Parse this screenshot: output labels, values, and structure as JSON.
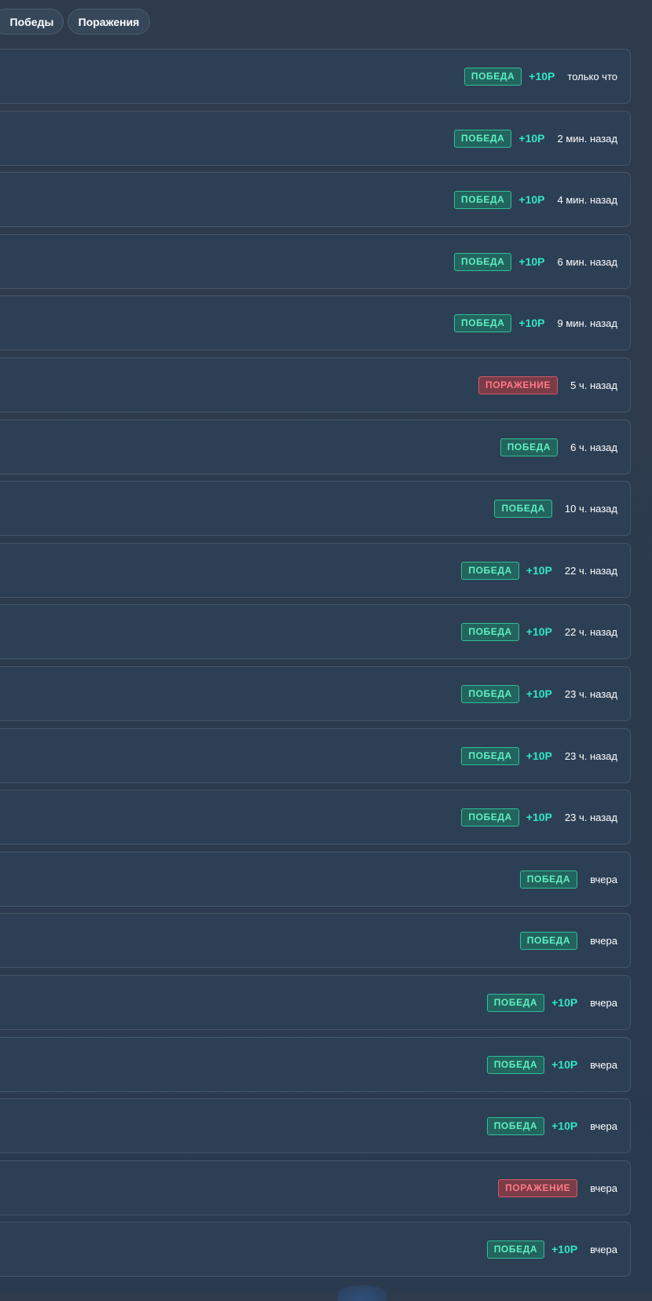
{
  "filters": {
    "wins_label": "Победы",
    "losses_label": "Поражения"
  },
  "colors": {
    "win_text": "#5ff0c2",
    "win_bg": "#23645e",
    "loss_text": "#ff7a86",
    "loss_bg": "#7a3c47",
    "reward": "#2ee8c4",
    "row_bg": "#2d3f54"
  },
  "history": [
    {
      "result": "ПОБЕДА",
      "type": "win",
      "reward": "+10Р",
      "time": "только что"
    },
    {
      "result": "ПОБЕДА",
      "type": "win",
      "reward": "+10Р",
      "time": "2 мин. назад"
    },
    {
      "result": "ПОБЕДА",
      "type": "win",
      "reward": "+10Р",
      "time": "4 мин. назад"
    },
    {
      "result": "ПОБЕДА",
      "type": "win",
      "reward": "+10Р",
      "time": "6 мин. назад"
    },
    {
      "result": "ПОБЕДА",
      "type": "win",
      "reward": "+10Р",
      "time": "9 мин. назад"
    },
    {
      "result": "ПОРАЖЕНИЕ",
      "type": "loss",
      "reward": "",
      "time": "5 ч. назад"
    },
    {
      "result": "ПОБЕДА",
      "type": "win",
      "reward": "",
      "time": "6 ч. назад"
    },
    {
      "result": "ПОБЕДА",
      "type": "win",
      "reward": "",
      "time": "10 ч. назад"
    },
    {
      "result": "ПОБЕДА",
      "type": "win",
      "reward": "+10Р",
      "time": "22 ч. назад"
    },
    {
      "result": "ПОБЕДА",
      "type": "win",
      "reward": "+10Р",
      "time": "22 ч. назад"
    },
    {
      "result": "ПОБЕДА",
      "type": "win",
      "reward": "+10Р",
      "time": "23 ч. назад"
    },
    {
      "result": "ПОБЕДА",
      "type": "win",
      "reward": "+10Р",
      "time": "23 ч. назад"
    },
    {
      "result": "ПОБЕДА",
      "type": "win",
      "reward": "+10Р",
      "time": "23 ч. назад"
    },
    {
      "result": "ПОБЕДА",
      "type": "win",
      "reward": "",
      "time": "вчера"
    },
    {
      "result": "ПОБЕДА",
      "type": "win",
      "reward": "",
      "time": "вчера"
    },
    {
      "result": "ПОБЕДА",
      "type": "win",
      "reward": "+10Р",
      "time": "вчера"
    },
    {
      "result": "ПОБЕДА",
      "type": "win",
      "reward": "+10Р",
      "time": "вчера"
    },
    {
      "result": "ПОБЕДА",
      "type": "win",
      "reward": "+10Р",
      "time": "вчера"
    },
    {
      "result": "ПОРАЖЕНИЕ",
      "type": "loss",
      "reward": "",
      "time": "вчера"
    },
    {
      "result": "ПОБЕДА",
      "type": "win",
      "reward": "+10Р",
      "time": "вчера"
    }
  ]
}
